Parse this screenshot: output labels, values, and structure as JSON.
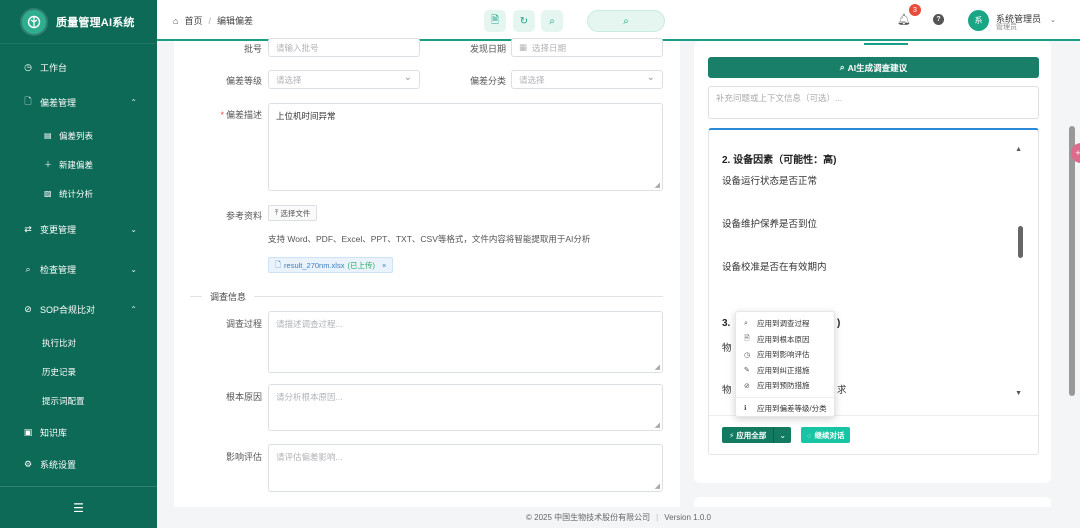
{
  "brand": {
    "title": "质量管理AI系统"
  },
  "sidebar": {
    "items": [
      {
        "label": "工作台"
      },
      {
        "label": "偏差管理"
      },
      {
        "label": "偏差列表"
      },
      {
        "label": "新建偏差"
      },
      {
        "label": "统计分析"
      },
      {
        "label": "变更管理"
      },
      {
        "label": "检查管理"
      },
      {
        "label": "SOP合规比对"
      },
      {
        "label": "执行比对"
      },
      {
        "label": "历史记录"
      },
      {
        "label": "提示词配置"
      },
      {
        "label": "知识库"
      },
      {
        "label": "系统设置"
      }
    ]
  },
  "header": {
    "breadcrumb": [
      "首页",
      "编辑偏差"
    ],
    "notifications": "3",
    "user": {
      "avatar_text": "系",
      "name": "系统管理员",
      "role": "管理员"
    }
  },
  "form": {
    "batch": {
      "label": "批号",
      "placeholder": "请输入批号"
    },
    "found_date": {
      "label": "发现日期",
      "placeholder": "选择日期"
    },
    "level": {
      "label": "偏差等级",
      "placeholder": "请选择"
    },
    "category": {
      "label": "偏差分类",
      "placeholder": "请选择"
    },
    "description": {
      "label": "偏差描述",
      "value": "上位机时间异常"
    },
    "reference": {
      "label": "参考资料",
      "upload_label": "选择文件",
      "help": "支持 Word、PDF、Excel、PPT、TXT、CSV等格式，文件内容将智能提取用于AI分析",
      "file_name": "result_270nm.xlsx",
      "file_status": "(已上传)"
    },
    "section_title": "调查信息",
    "process": {
      "label": "调查过程",
      "placeholder": "请描述调查过程..."
    },
    "root_cause": {
      "label": "根本原因",
      "placeholder": "请分析根本原因..."
    },
    "impact": {
      "label": "影响评估",
      "placeholder": "请评估偏差影响..."
    }
  },
  "ai": {
    "generate_label": "AI生成调查建议",
    "context_placeholder": "补充问题或上下文信息（可选）...",
    "heading_2": "2. 设备因素（可能性：高)",
    "lines": [
      "设备运行状态是否正常",
      "设备维护保养是否到位",
      "设备校准是否在有效期内"
    ],
    "heading_3_start": "3.",
    "heading_3_end": ")",
    "line_4_start": "物",
    "line_5_start": "物",
    "line_5_end": "求",
    "apply_all_label": "应用全部",
    "continue_label": "继续对话",
    "menu": [
      {
        "label": "应用到调查过程",
        "icon": "search-icon"
      },
      {
        "label": "应用到根本原因",
        "icon": "document-icon"
      },
      {
        "label": "应用到影响评估",
        "icon": "warning-icon"
      },
      {
        "label": "应用到纠正措施",
        "icon": "edit-icon"
      },
      {
        "label": "应用到预防措施",
        "icon": "shield-check-icon"
      },
      {
        "label": "应用到偏差等级/分类",
        "icon": "info-icon"
      }
    ]
  },
  "footer": {
    "copyright": "© 2025 中国生物技术股份有限公司",
    "version": "Version 1.0.0"
  },
  "colors": {
    "primary": "#0d6a57",
    "accent": "#1a9e86",
    "badge": "#e74c3c"
  }
}
